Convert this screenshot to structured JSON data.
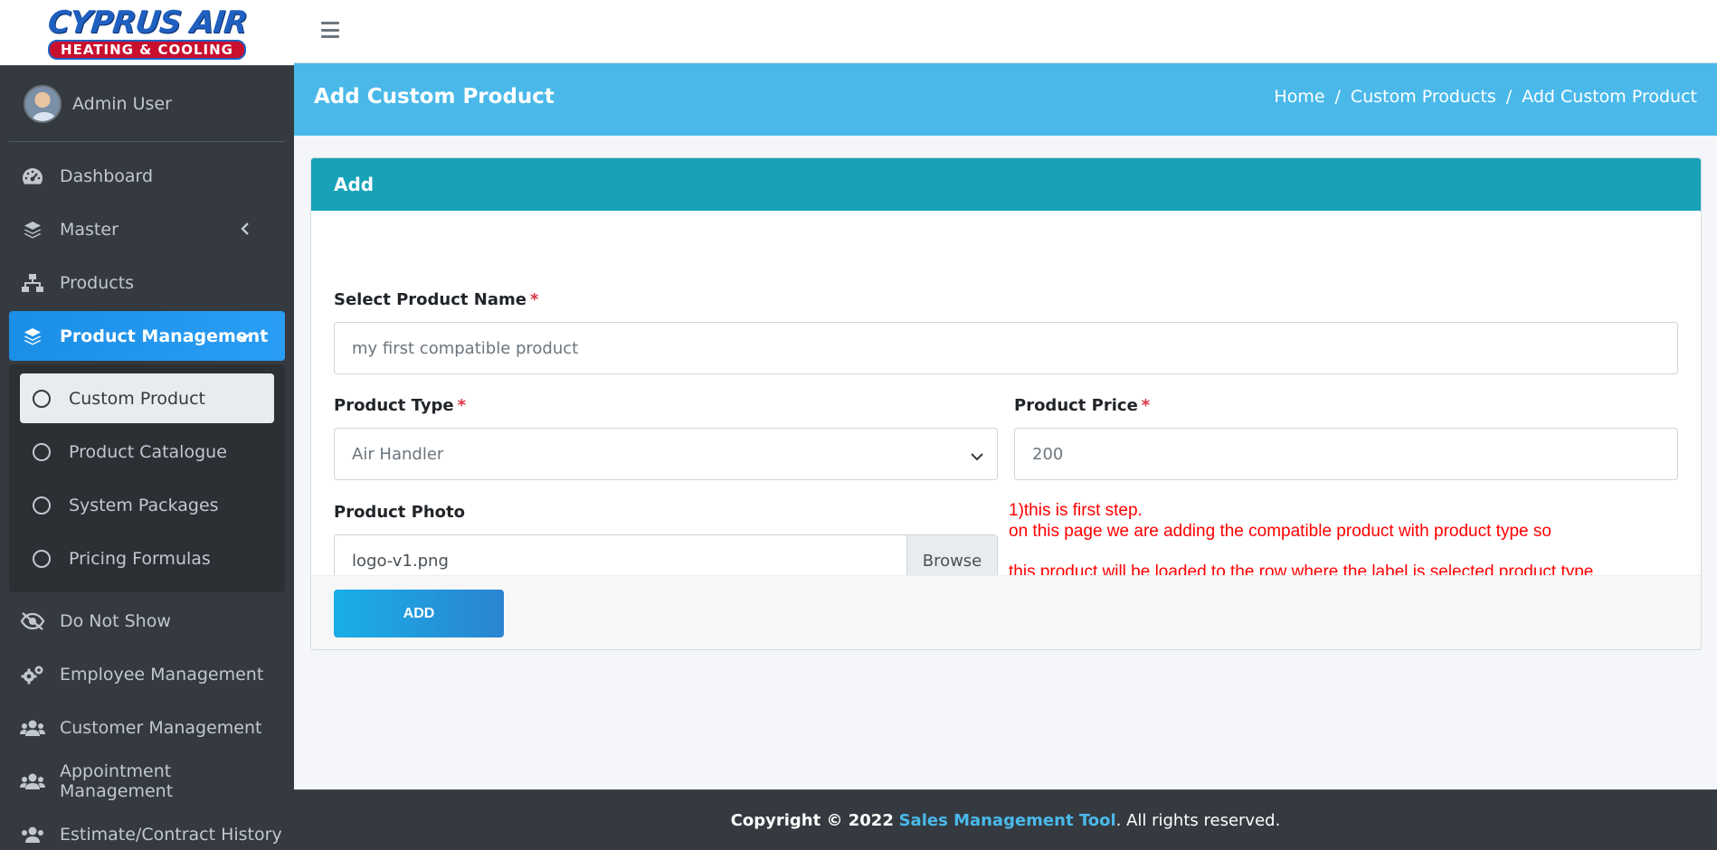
{
  "brand": {
    "logo_top": "CYPRUS AIR",
    "logo_bottom": "HEATING & COOLING"
  },
  "user": {
    "name": "Admin User"
  },
  "sidebar": {
    "items": [
      {
        "label": "Dashboard",
        "icon": "tachometer-icon"
      },
      {
        "label": "Master",
        "icon": "layers-icon"
      },
      {
        "label": "Products",
        "icon": "sitemap-icon"
      },
      {
        "label": "Product Management",
        "icon": "layers-icon"
      },
      {
        "label": "Do Not Show",
        "icon": "eye-slash-icon"
      },
      {
        "label": "Employee Management",
        "icon": "gears-icon"
      },
      {
        "label": "Customer Management",
        "icon": "users-icon"
      },
      {
        "label": "Appointment Management",
        "icon": "users-icon"
      },
      {
        "label": "Estimate/Contract History",
        "icon": "users-icon"
      }
    ],
    "subitems": [
      {
        "label": "Custom Product"
      },
      {
        "label": "Product Catalogue"
      },
      {
        "label": "System Packages"
      },
      {
        "label": "Pricing Formulas"
      }
    ]
  },
  "header": {
    "title": "Add Custom Product",
    "breadcrumb": [
      "Home",
      "Custom Products",
      "Add Custom Product"
    ],
    "separator": "/"
  },
  "form": {
    "card_title": "Add",
    "product_name_label": "Select Product Name",
    "product_name_value": "my first compatible product",
    "product_type_label": "Product Type",
    "product_type_value": "Air Handler",
    "product_price_label": "Product Price",
    "product_price_value": "200",
    "product_photo_label": "Product Photo",
    "product_photo_value": "logo-v1.png",
    "browse_label": "Browse",
    "required_mark": "*",
    "add_button": "ADD",
    "note_line1": "1)this is first step.",
    "note_line2": "on this page we are adding the compatible product with product type so",
    "note_line3": "this product will be loaded to the row where the label is selected product type."
  },
  "footer": {
    "copyright": "Copyright © 2022",
    "brand": "Sales Management Tool",
    "suffix": ". All rights reserved."
  },
  "colors": {
    "sidebar_bg": "#343a40",
    "header_bg": "#4ab9ea",
    "card_header_bg": "#17a2b8",
    "active_nav": "#1e90e6",
    "note_red": "#ff0000"
  }
}
